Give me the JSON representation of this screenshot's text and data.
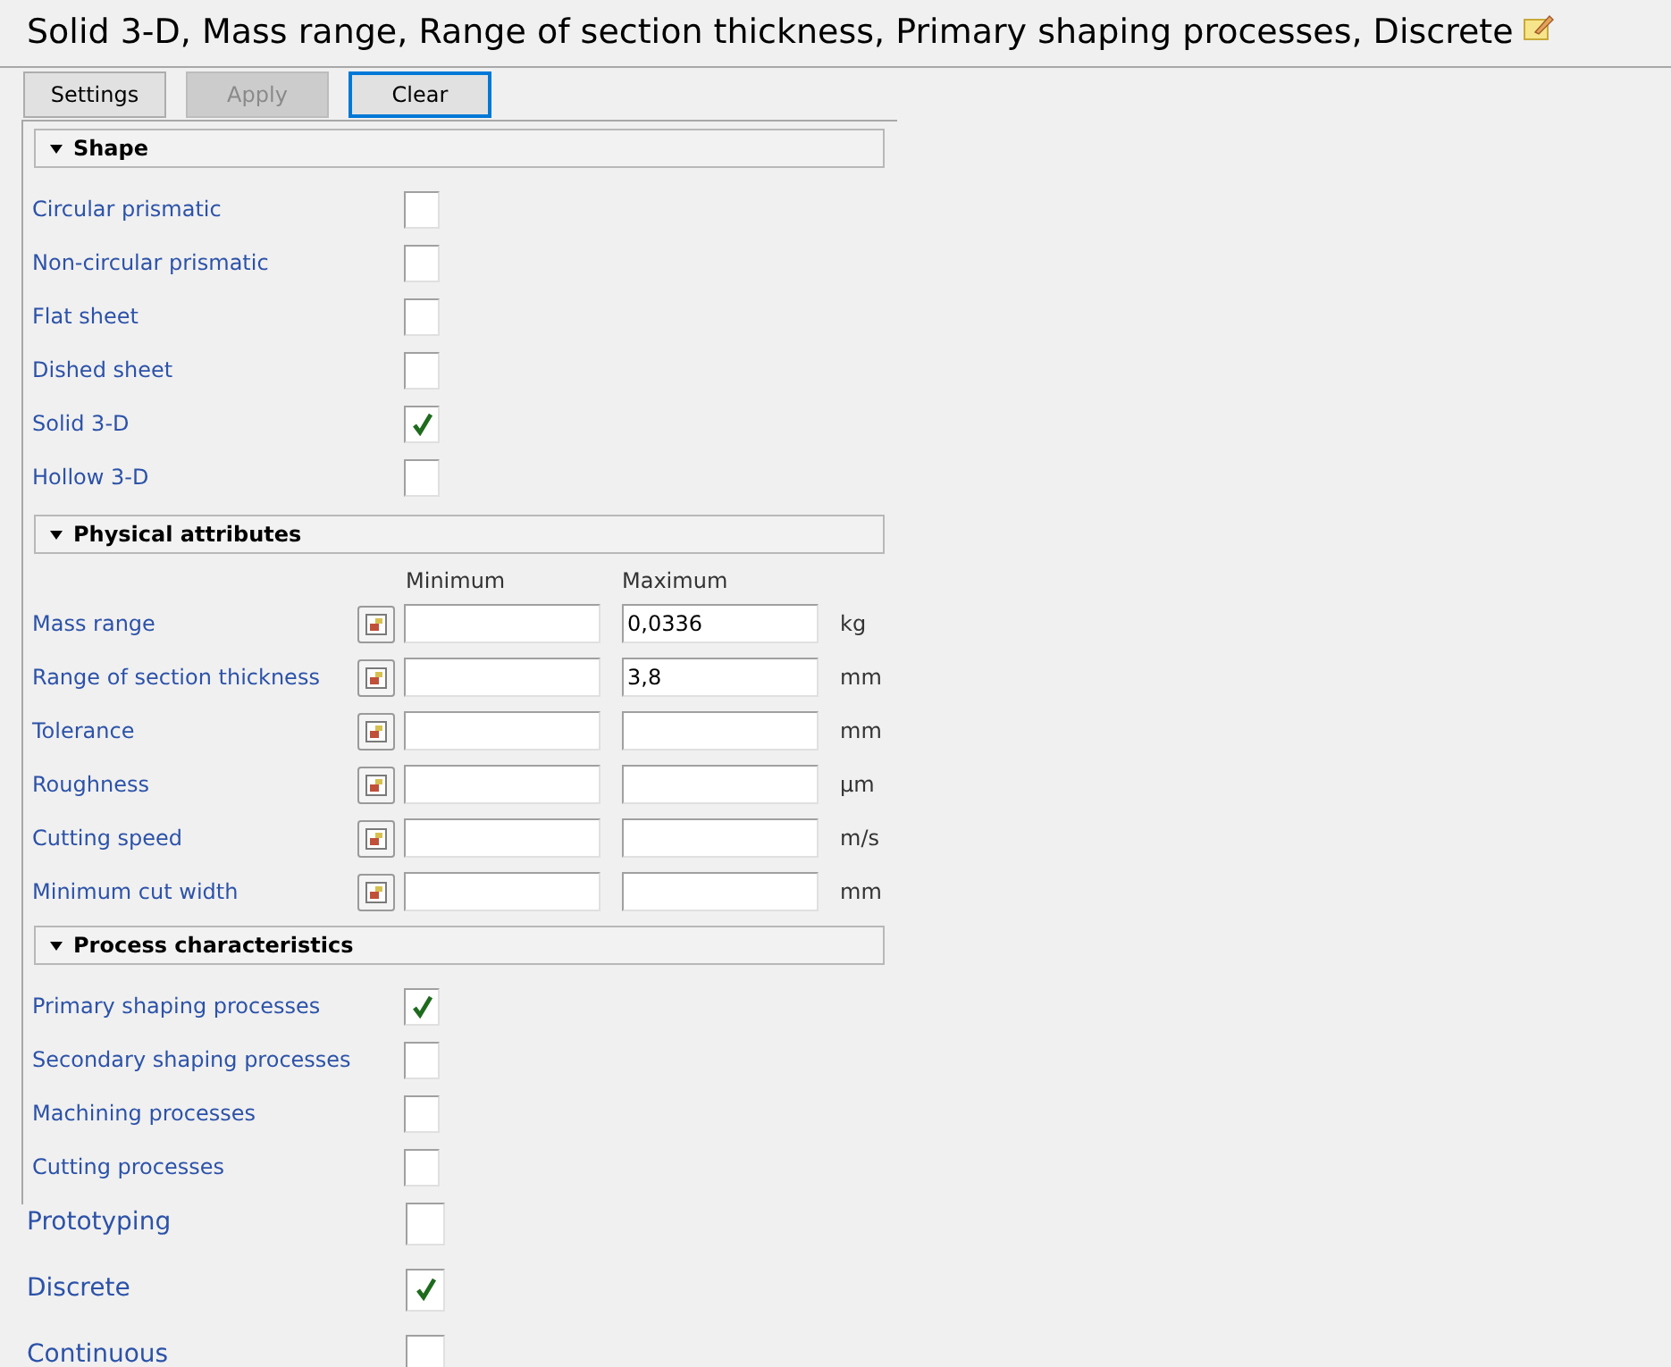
{
  "title": "Solid 3-D, Mass range, Range of section thickness, Primary shaping processes, Discrete",
  "toolbar": [
    {
      "label": "Settings",
      "disabled": false,
      "focused": false
    },
    {
      "label": "Apply",
      "disabled": true,
      "focused": false
    },
    {
      "label": "Clear",
      "disabled": false,
      "focused": true
    }
  ],
  "sections": [
    {
      "title": "Shape",
      "expanded": true,
      "kind": "checks",
      "rows": [
        {
          "label": "Circular prismatic",
          "checked": false
        },
        {
          "label": "Non-circular prismatic",
          "checked": false
        },
        {
          "label": "Flat sheet",
          "checked": false
        },
        {
          "label": "Dished sheet",
          "checked": false
        },
        {
          "label": "Solid 3-D",
          "checked": true
        },
        {
          "label": "Hollow 3-D",
          "checked": false
        }
      ]
    },
    {
      "title": "Physical attributes",
      "expanded": true,
      "kind": "ranges",
      "columns": [
        "Minimum",
        "Maximum"
      ],
      "rows": [
        {
          "label": "Mass range",
          "minimum": "",
          "maximum": "0,0336",
          "unit": "kg"
        },
        {
          "label": "Range of section thickness",
          "minimum": "",
          "maximum": "3,8",
          "unit": "mm"
        },
        {
          "label": "Tolerance",
          "minimum": "",
          "maximum": "",
          "unit": "mm"
        },
        {
          "label": "Roughness",
          "minimum": "",
          "maximum": "",
          "unit": "µm"
        },
        {
          "label": "Cutting speed",
          "minimum": "",
          "maximum": "",
          "unit": "m/s"
        },
        {
          "label": "Minimum cut width",
          "minimum": "",
          "maximum": "",
          "unit": "mm"
        }
      ]
    },
    {
      "title": "Process characteristics",
      "expanded": true,
      "kind": "checks",
      "rows": [
        {
          "label": "Primary shaping processes",
          "checked": true
        },
        {
          "label": "Secondary shaping processes",
          "checked": false
        },
        {
          "label": "Machining processes",
          "checked": false
        },
        {
          "label": "Cutting processes",
          "checked": false
        }
      ]
    }
  ],
  "extra_rows": [
    {
      "label": "Prototyping",
      "checked": false
    },
    {
      "label": "Discrete",
      "checked": true
    },
    {
      "label": "Continuous",
      "checked": false
    }
  ]
}
